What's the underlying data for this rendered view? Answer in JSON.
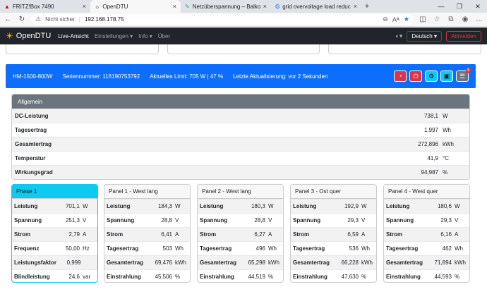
{
  "browser": {
    "tabs": [
      {
        "title": "FRITZ!Box 7490",
        "icon": "fritz-icon",
        "active": false
      },
      {
        "title": "OpenDTU",
        "icon": "opendtu-icon",
        "active": true
      },
      {
        "title": "Netzüberspannung – Balkonsolar",
        "icon": "page-icon",
        "active": false
      },
      {
        "title": "grid overvoltage load reduction",
        "icon": "google-icon",
        "active": false
      }
    ],
    "security": "Nicht sicher",
    "url": "192.168.178.75"
  },
  "navbar": {
    "brand": "OpenDTU",
    "links": [
      "Live-Ansicht",
      "Einstellungen ▾",
      "Info ▾",
      "Über"
    ],
    "language": "Deutsch ▾",
    "logout": "Abmelden"
  },
  "inverter": {
    "name": "HM-1500-800W",
    "serial": "Seriennummer: 116190753792",
    "limit": "Aktuelles Limit: 705 W | 47 %",
    "updated": "Letzte Aktualisierung: vor 2 Sekunden",
    "badge": "8"
  },
  "general": {
    "title": "Allgemein",
    "rows": [
      {
        "k": "DC-Leistung",
        "v": "738,1",
        "u": "W"
      },
      {
        "k": "Tagesertrag",
        "v": "1.997",
        "u": "Wh"
      },
      {
        "k": "Gesamtertrag",
        "v": "272,896",
        "u": "kWh"
      },
      {
        "k": "Temperatur",
        "v": "41,9",
        "u": "°C"
      },
      {
        "k": "Wirkungsgrad",
        "v": "94,987",
        "u": "%"
      }
    ]
  },
  "cards": [
    {
      "title": "Phase 1",
      "rows": [
        {
          "k": "Leistung",
          "v": "701,1",
          "u": "W"
        },
        {
          "k": "Spannung",
          "v": "251,3",
          "u": "V"
        },
        {
          "k": "Strom",
          "v": "2,79",
          "u": "A"
        },
        {
          "k": "Frequenz",
          "v": "50,00",
          "u": "Hz"
        },
        {
          "k": "Leistungsfaktor",
          "v": "0,999",
          "u": ""
        },
        {
          "k": "Blindleistung",
          "v": "24,6",
          "u": "var"
        }
      ]
    },
    {
      "title": "Panel 1 - West lang",
      "rows": [
        {
          "k": "Leistung",
          "v": "184,3",
          "u": "W"
        },
        {
          "k": "Spannung",
          "v": "28,8",
          "u": "V"
        },
        {
          "k": "Strom",
          "v": "6,41",
          "u": "A"
        },
        {
          "k": "Tagesertrag",
          "v": "503",
          "u": "Wh"
        },
        {
          "k": "Gesamtertrag",
          "v": "69,476",
          "u": "kWh"
        },
        {
          "k": "Einstrahlung",
          "v": "45,506",
          "u": "%"
        }
      ]
    },
    {
      "title": "Panel 2 - West lang",
      "rows": [
        {
          "k": "Leistung",
          "v": "180,3",
          "u": "W"
        },
        {
          "k": "Spannung",
          "v": "28,8",
          "u": "V"
        },
        {
          "k": "Strom",
          "v": "6,27",
          "u": "A"
        },
        {
          "k": "Tagesertrag",
          "v": "496",
          "u": "Wh"
        },
        {
          "k": "Gesamtertrag",
          "v": "65,298",
          "u": "kWh"
        },
        {
          "k": "Einstrahlung",
          "v": "44,519",
          "u": "%"
        }
      ]
    },
    {
      "title": "Panel 3 - Ost quer",
      "rows": [
        {
          "k": "Leistung",
          "v": "192,9",
          "u": "W"
        },
        {
          "k": "Spannung",
          "v": "29,3",
          "u": "V"
        },
        {
          "k": "Strom",
          "v": "6,59",
          "u": "A"
        },
        {
          "k": "Tagesertrag",
          "v": "536",
          "u": "Wh"
        },
        {
          "k": "Gesamtertrag",
          "v": "66,228",
          "u": "kWh"
        },
        {
          "k": "Einstrahlung",
          "v": "47,630",
          "u": "%"
        }
      ]
    },
    {
      "title": "Panel 4 - West quer",
      "rows": [
        {
          "k": "Leistung",
          "v": "180,6",
          "u": "W"
        },
        {
          "k": "Spannung",
          "v": "29,3",
          "u": "V"
        },
        {
          "k": "Strom",
          "v": "6,16",
          "u": "A"
        },
        {
          "k": "Tagesertrag",
          "v": "462",
          "u": "Wh"
        },
        {
          "k": "Gesamtertrag",
          "v": "71,894",
          "u": "kWh"
        },
        {
          "k": "Einstrahlung",
          "v": "44,593",
          "u": "%"
        }
      ]
    }
  ],
  "colors": {
    "primary": "#0d6efd",
    "navbar": "#212529",
    "phase": "#0dcaf0",
    "danger": "#dc3545"
  }
}
